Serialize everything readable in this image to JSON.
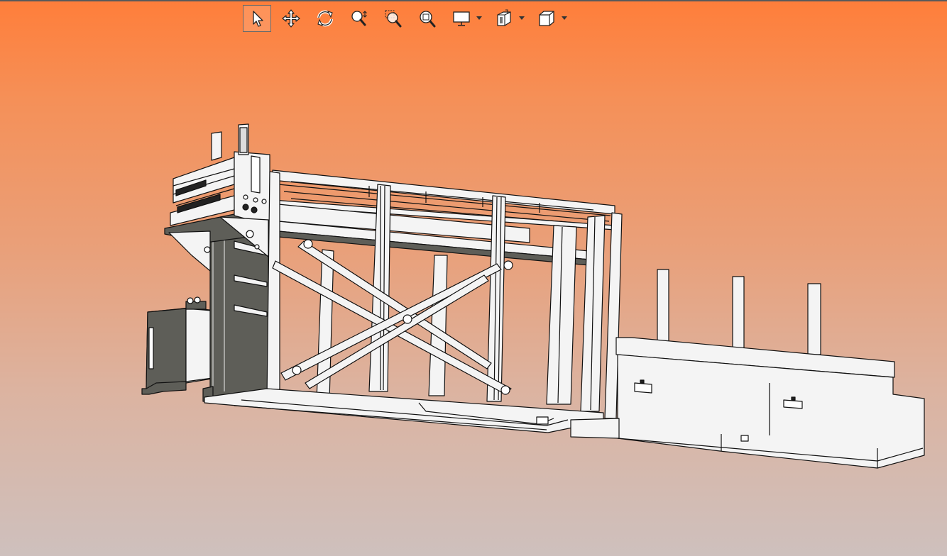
{
  "viewer": {
    "background_top": "#ff7e3a",
    "background_bottom": "#cec0bd"
  },
  "toolbar": {
    "tools": [
      {
        "id": "select",
        "icon": "pointer-arrow-icon",
        "active": true
      },
      {
        "id": "pan",
        "icon": "move-arrows-icon",
        "active": false
      },
      {
        "id": "rotate",
        "icon": "rotate-icon",
        "active": false
      },
      {
        "id": "zoom",
        "icon": "zoom-magnifier-icon",
        "active": false
      },
      {
        "id": "zoom-window",
        "icon": "zoom-window-icon",
        "active": false
      },
      {
        "id": "zoom-fit",
        "icon": "zoom-fit-icon",
        "active": false
      },
      {
        "id": "display",
        "icon": "monitor-icon",
        "dropdown": true
      },
      {
        "id": "section",
        "icon": "section-view-icon",
        "dropdown": true
      },
      {
        "id": "view-orientation",
        "icon": "cube-icon",
        "dropdown": true
      }
    ]
  },
  "model": {
    "line_color": "#111111",
    "fill_light": "#f2f2f2",
    "fill_dark": "#5e5e58"
  }
}
